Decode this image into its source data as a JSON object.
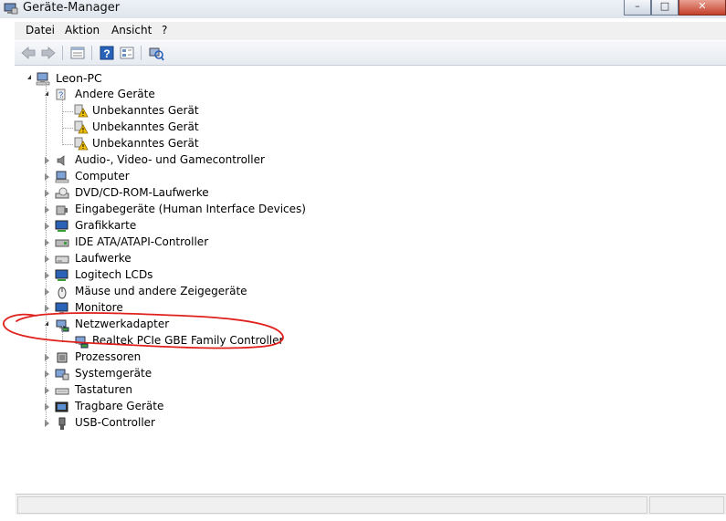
{
  "window": {
    "title": "Geräte-Manager",
    "minimize": "–",
    "maximize": "□",
    "close": "✕"
  },
  "menubar": [
    "Datei",
    "Aktion",
    "Ansicht",
    "?"
  ],
  "toolbar": [
    "back-arrow-icon",
    "forward-arrow-icon",
    "properties-icon",
    "help-icon",
    "view-icon",
    "scan-hardware-icon"
  ],
  "tree": {
    "root": "Leon-PC",
    "categories": [
      {
        "label": "Andere Geräte",
        "expanded": true,
        "children": [
          "Unbekanntes Gerät",
          "Unbekanntes Gerät",
          "Unbekanntes Gerät"
        ]
      },
      {
        "label": "Audio-, Video- und Gamecontroller",
        "expanded": false
      },
      {
        "label": "Computer",
        "expanded": false
      },
      {
        "label": "DVD/CD-ROM-Laufwerke",
        "expanded": false
      },
      {
        "label": "Eingabegeräte (Human Interface Devices)",
        "expanded": false
      },
      {
        "label": "Grafikkarte",
        "expanded": false
      },
      {
        "label": "IDE ATA/ATAPI-Controller",
        "expanded": false
      },
      {
        "label": "Laufwerke",
        "expanded": false
      },
      {
        "label": "Logitech LCDs",
        "expanded": false
      },
      {
        "label": "Mäuse und andere Zeigegeräte",
        "expanded": false
      },
      {
        "label": "Monitore",
        "expanded": false
      },
      {
        "label": "Netzwerkadapter",
        "expanded": true,
        "children": [
          "Realtek PCIe GBE Family Controller"
        ]
      },
      {
        "label": "Prozessoren",
        "expanded": false
      },
      {
        "label": "Systemgeräte",
        "expanded": false
      },
      {
        "label": "Tastaturen",
        "expanded": false
      },
      {
        "label": "Tragbare Geräte",
        "expanded": false
      },
      {
        "label": "USB-Controller",
        "expanded": false
      }
    ]
  },
  "colors": {
    "annotation": "#e0201c",
    "warning": "#f2c200",
    "accent": "#1e5fb4"
  }
}
